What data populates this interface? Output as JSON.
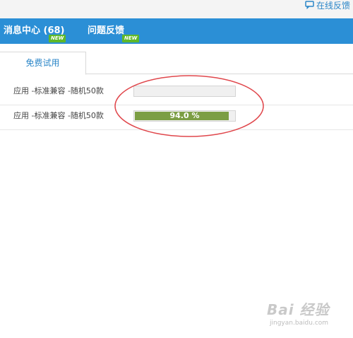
{
  "topbar": {
    "online_feedback_label": "在线反馈",
    "online_feedback_icon": "chat-bubble-icon"
  },
  "nav": {
    "items": [
      {
        "label": "消息中心 (68)",
        "badge": "NEW"
      },
      {
        "label": "问题反馈",
        "badge": "NEW"
      }
    ]
  },
  "tabs": [
    {
      "label": "免费试用",
      "active": true
    }
  ],
  "rows": [
    {
      "label": "应用 -标准兼容 -随机50款",
      "progress_text": "",
      "progress_fraction": 0.0
    },
    {
      "label": "应用 -标准兼容 -随机50款",
      "progress_text": "94.0 %",
      "progress_fraction": 0.94
    }
  ],
  "watermark": {
    "logo": "Bai 经验",
    "url": "jingyan.baidu.com"
  },
  "colors": {
    "nav_bg": "#2b8fd6",
    "badge_bg": "#5fb829",
    "progress_fill": "#7c9e44",
    "annotation": "#e0474c",
    "link": "#2b86c8"
  }
}
